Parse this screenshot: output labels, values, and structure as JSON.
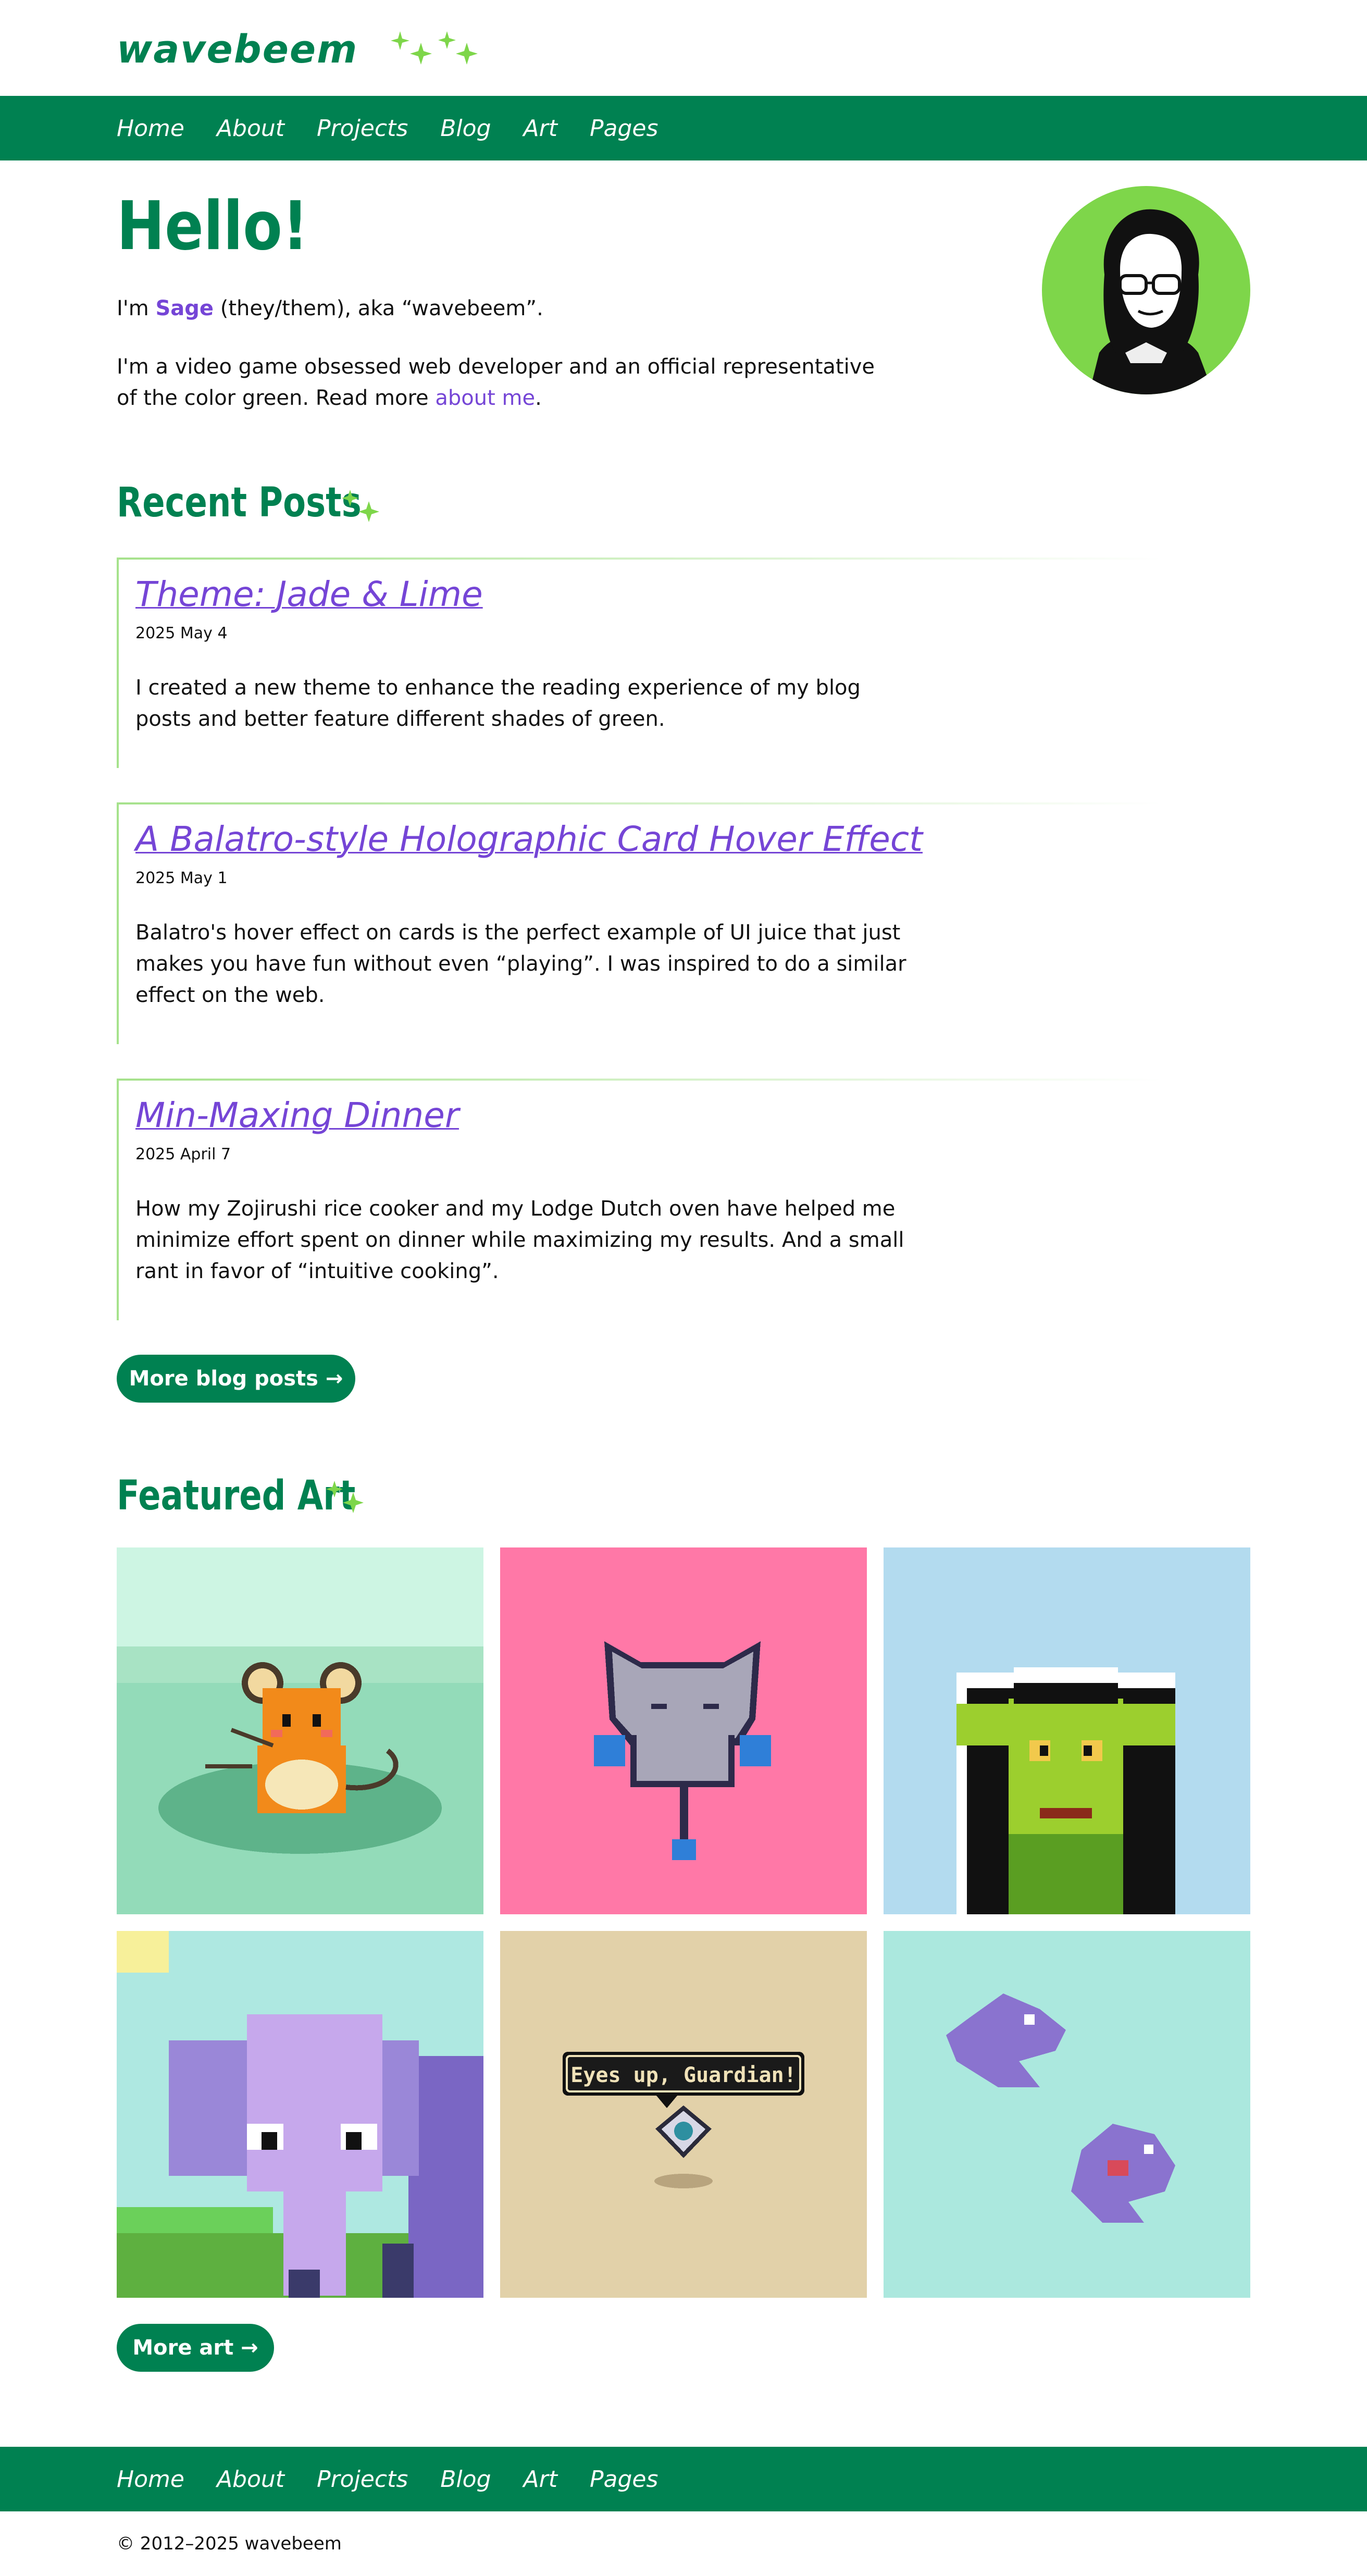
{
  "site": {
    "logo": "wavebeem"
  },
  "nav": [
    "Home",
    "About",
    "Projects",
    "Blog",
    "Art",
    "Pages"
  ],
  "hero": {
    "title": "Hello!",
    "intro_prefix": "I'm ",
    "name": "Sage",
    "intro_suffix": " (they/them), aka “wavebeem”.",
    "para2_line1": "I'm a video game obsessed web developer and an official representative",
    "para2_line2_prefix": "of the color green. Read more ",
    "about_link": "about me",
    "para2_line2_suffix": "."
  },
  "recent": {
    "heading": "Recent Posts",
    "posts": [
      {
        "title": "Theme: Jade & Lime",
        "date": "2025 May 4",
        "lines": [
          "I created a new theme to enhance the reading experience of my blog",
          "posts and better feature different shades of green."
        ]
      },
      {
        "title": "A Balatro-style Holographic Card Hover Effect",
        "date": "2025 May 1",
        "lines": [
          "Balatro's hover effect on cards is the perfect example of UI juice that just",
          "makes you have fun without even “playing”. I was inspired to do a similar",
          "effect on the web."
        ]
      },
      {
        "title": "Min-Maxing Dinner",
        "date": "2025 April 7",
        "lines": [
          "How my Zojirushi rice cooker and my Lodge Dutch oven have helped me",
          "minimize effort spent on dinner while maximizing my results. And a small",
          "rant in favor of “intuitive cooking”."
        ]
      }
    ],
    "more_label": "More blog posts →"
  },
  "art": {
    "heading": "Featured Art",
    "bubble_text": "Eyes up, Guardian!",
    "more_label": "More art →"
  },
  "footer": {
    "copyright": "© 2012–2025 wavebeem"
  },
  "colors": {
    "brand": "#008151",
    "link": "#7545d6",
    "lime": "#7ed64a"
  }
}
